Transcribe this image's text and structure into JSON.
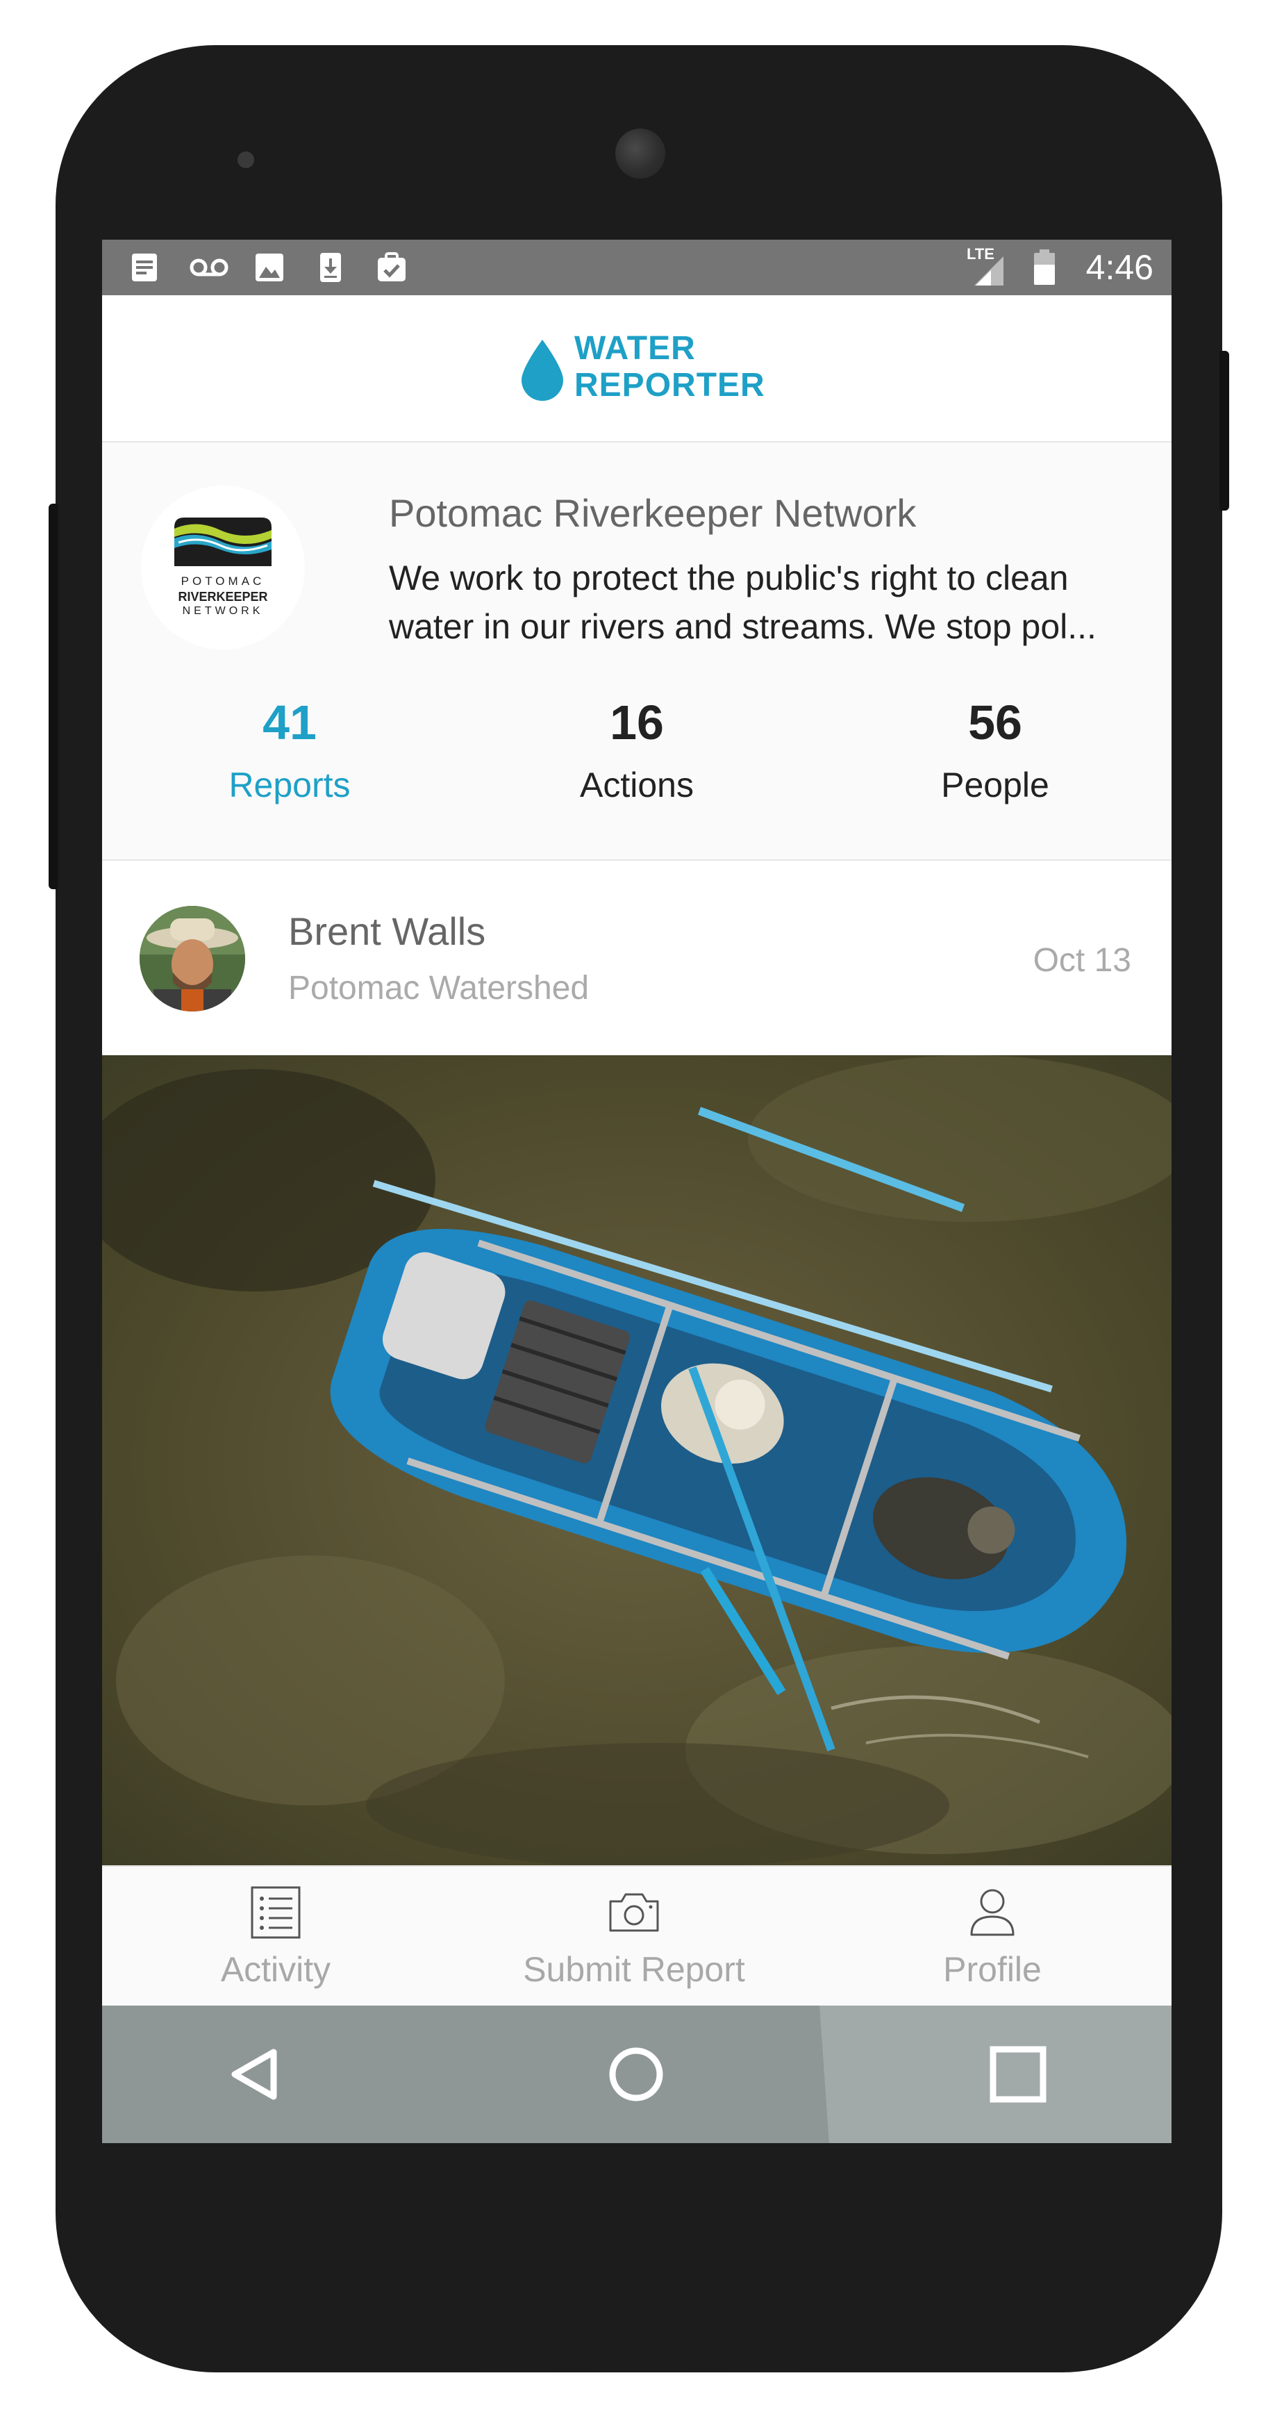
{
  "status_bar": {
    "time": "4:46",
    "network": "LTE",
    "notification_icons": [
      "document-icon",
      "voicemail-icon",
      "image-icon",
      "download-icon",
      "clipboard-check-icon"
    ]
  },
  "header": {
    "logo_line1": "WATER",
    "logo_line2": "REPORTER",
    "brand_color": "#1ea0c7"
  },
  "organization": {
    "logo_line1": "POTOMAC",
    "logo_line2": "RIVERKEEPER",
    "logo_line3": "NETWORK",
    "name": "Potomac Riverkeeper Network",
    "description": "We work to protect the public's right to clean water in our rivers and streams. We stop pol...",
    "stats": [
      {
        "value": "41",
        "label": "Reports",
        "active": true
      },
      {
        "value": "16",
        "label": "Actions",
        "active": false
      },
      {
        "value": "56",
        "label": "People",
        "active": false
      }
    ]
  },
  "report": {
    "author": "Brent Walls",
    "location": "Potomac Watershed",
    "date": "Oct 13",
    "photo": "aerial-raft-photo"
  },
  "tabs": [
    {
      "label": "Activity",
      "icon": "activity-list-icon"
    },
    {
      "label": "Submit Report",
      "icon": "camera-icon"
    },
    {
      "label": "Profile",
      "icon": "person-icon"
    }
  ],
  "nav": [
    "back-icon",
    "home-icon",
    "recents-icon"
  ]
}
